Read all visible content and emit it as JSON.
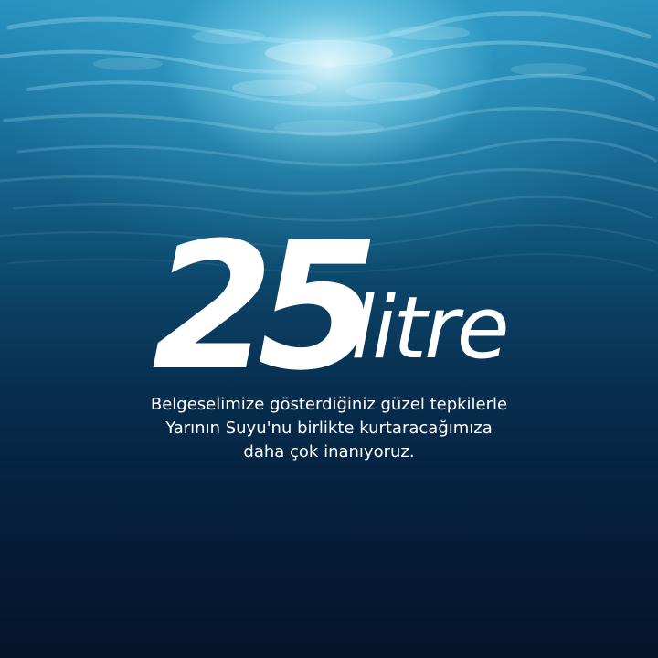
{
  "headline": {
    "number": "25",
    "unit": "litre"
  },
  "caption": {
    "lines": [
      "Belgeselimize gösterdiğiniz güzel tepkilerle",
      "Yarının Suyu'nu birlikte kurtaracağımıza",
      "daha çok inanıyoruz."
    ]
  },
  "colors": {
    "water_surface": "#2a93bf",
    "water_deep": "#04142a",
    "sunlight": "#e6faff",
    "text": "#ffffff"
  }
}
